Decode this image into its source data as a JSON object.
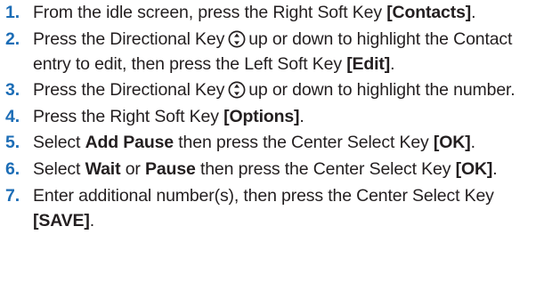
{
  "steps": [
    {
      "num": "1.",
      "parts": [
        {
          "t": "text",
          "v": "From the idle screen, press the Right Soft Key "
        },
        {
          "t": "bold",
          "v": "[Contacts]"
        },
        {
          "t": "text",
          "v": "."
        }
      ]
    },
    {
      "num": "2.",
      "parts": [
        {
          "t": "text",
          "v": "Press the Directional Key"
        },
        {
          "t": "icon",
          "name": "directional-key-icon"
        },
        {
          "t": "text",
          "v": "up or down to highlight the Contact entry to edit, then press the Left Soft Key "
        },
        {
          "t": "bold",
          "v": "[Edit]"
        },
        {
          "t": "text",
          "v": "."
        }
      ]
    },
    {
      "num": "3.",
      "parts": [
        {
          "t": "text",
          "v": "Press the Directional Key"
        },
        {
          "t": "icon",
          "name": "directional-key-icon"
        },
        {
          "t": "text",
          "v": "up or down to highlight the number."
        }
      ]
    },
    {
      "num": "4.",
      "parts": [
        {
          "t": "text",
          "v": "Press the Right Soft Key "
        },
        {
          "t": "bold",
          "v": "[Options]"
        },
        {
          "t": "text",
          "v": "."
        }
      ]
    },
    {
      "num": "5.",
      "parts": [
        {
          "t": "text",
          "v": "Select "
        },
        {
          "t": "bold",
          "v": "Add Pause"
        },
        {
          "t": "text",
          "v": " then press the Center Select Key "
        },
        {
          "t": "bold",
          "v": "[OK]"
        },
        {
          "t": "text",
          "v": "."
        }
      ]
    },
    {
      "num": "6.",
      "parts": [
        {
          "t": "text",
          "v": "Select "
        },
        {
          "t": "bold",
          "v": "Wait"
        },
        {
          "t": "text",
          "v": " or "
        },
        {
          "t": "bold",
          "v": "Pause"
        },
        {
          "t": "text",
          "v": " then press the Center Select Key "
        },
        {
          "t": "bold",
          "v": "[OK]"
        },
        {
          "t": "text",
          "v": "."
        }
      ]
    },
    {
      "num": "7.",
      "parts": [
        {
          "t": "text",
          "v": "Enter additional number(s), then press the Center Select Key "
        },
        {
          "t": "bold",
          "v": "[SAVE]"
        },
        {
          "t": "text",
          "v": "."
        }
      ]
    }
  ],
  "colors": {
    "step_number": "#1c6db6",
    "text": "#231f20"
  }
}
